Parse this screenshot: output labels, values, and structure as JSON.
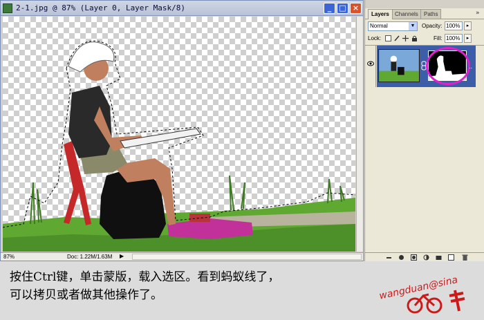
{
  "document": {
    "title": "2-1.jpg @ 87% (Layer 0, Layer Mask/8)",
    "buttons": {
      "minimize": "_",
      "maximize": "□",
      "close": "×"
    },
    "status": {
      "zoom": "87%",
      "doc_info": "Doc: 1.22M/1.63M",
      "arrow": "▶"
    }
  },
  "palette": {
    "tabs": [
      "Layers",
      "Channels",
      "Paths"
    ],
    "active_tab": "Layers",
    "menu": "»",
    "blend_mode": "Normal",
    "opacity_label": "Opacity:",
    "opacity_value": "100%",
    "lock_label": "Lock:",
    "fill_label": "Fill:",
    "fill_value": "100%",
    "arrow": "▸",
    "layer": {
      "name_dots": "..",
      "mask_highlight_color": "#e020c8"
    }
  },
  "caption": {
    "line1": "按住Ctrl键，单击蒙版，载入选区。看到蚂蚁线了，",
    "line2": "可以拷贝或者做其他操作了。"
  },
  "watermark": {
    "text": "wangduan@sina",
    "color": "#cc1a1a"
  },
  "colors": {
    "selection_tab": "#3c5ea8",
    "canvas_check": "#cfcfcf"
  }
}
